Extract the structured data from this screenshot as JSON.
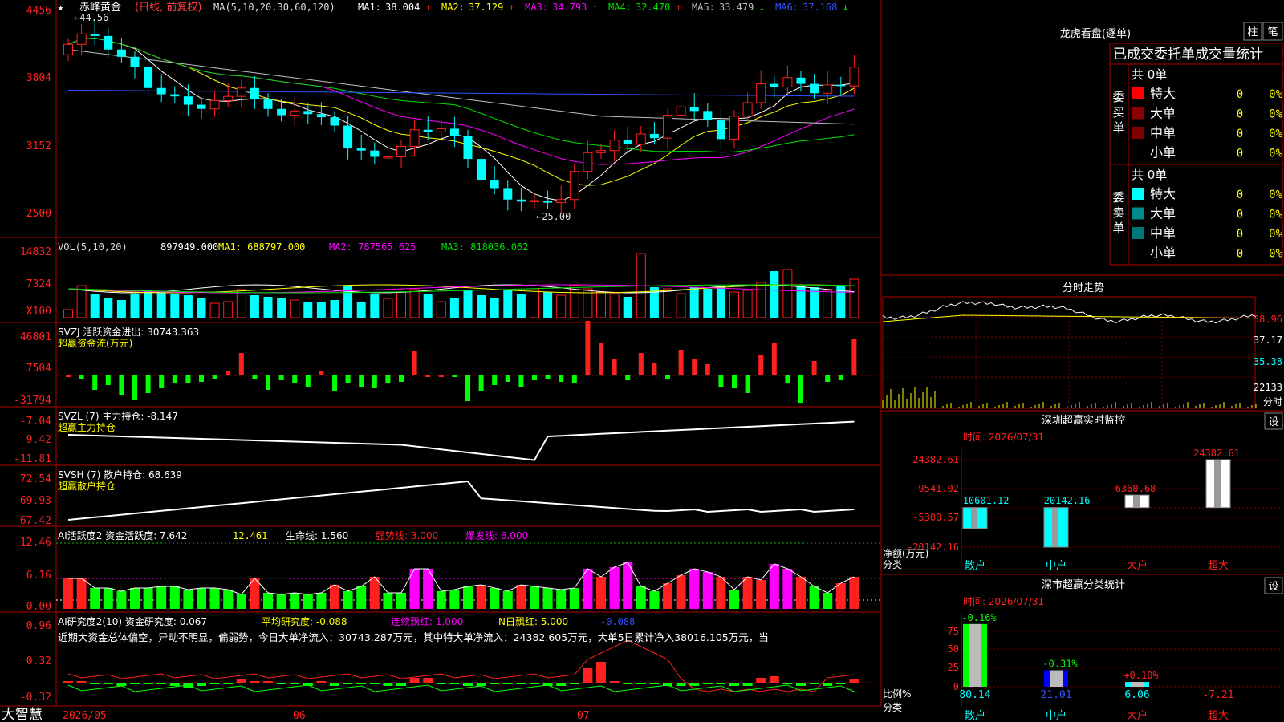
{
  "stock": {
    "name": "赤峰黄金",
    "period": "(日线, 前复权)",
    "ma_params": "MA(5,10,20,30,60,120)",
    "mas": [
      {
        "name": "MA1:",
        "value": "38.004",
        "arrow": "↑",
        "color": "#ffffff"
      },
      {
        "name": "MA2:",
        "value": "37.129",
        "arrow": "↑",
        "color": "#ffff00"
      },
      {
        "name": "MA3:",
        "value": "34.793",
        "arrow": "↑",
        "color": "#ff00ff"
      },
      {
        "name": "MA4:",
        "value": "32.470",
        "arrow": "↑",
        "color": "#00e000"
      },
      {
        "name": "MA5:",
        "value": "33.479",
        "arrow": "↓",
        "color": "#c0c0c0"
      },
      {
        "name": "MA6:",
        "value": "37.168",
        "arrow": "↓",
        "color": "#3050ff"
      }
    ],
    "high_marker": "←44.56",
    "low_marker": "←25.00"
  },
  "left_axis": {
    "main": [
      "4456",
      "3804",
      "3152",
      "2500"
    ],
    "vol": [
      "14832",
      "7324",
      "X100"
    ],
    "svzj": [
      "46801",
      "7504",
      "-31794"
    ],
    "svzl": [
      "-7.04",
      "-9.42",
      "-11.81"
    ],
    "svsh": [
      "72.54",
      "69.93",
      "67.42"
    ],
    "ai1": [
      "12.46",
      "6.16",
      "0.00"
    ],
    "ai2": [
      "0.96",
      "0.32",
      "-0.32"
    ]
  },
  "indicators": {
    "vol": {
      "params": "VOL(5,10,20)",
      "value": "897949.000",
      "ma1": "MA1: 688797.000",
      "ma2": "MA2: 787565.625",
      "ma3": "MA3: 818036.062"
    },
    "svzj": {
      "title": "SVZJ  活跃资金进出: 30743.363",
      "subtitle": "超赢资金流(万元)"
    },
    "svzl": {
      "title": "SVZL (7) 主力持仓: -8.147",
      "subtitle": "超赢主力持仓"
    },
    "svsh": {
      "title": "SVSH (7) 散户持仓: 68.639",
      "subtitle": "超赢散户持仓"
    },
    "ai1": {
      "title": "AI活跃度2 资金活跃度: 7.642",
      "v2": "12.461",
      "life": "生命线: 1.560",
      "strong": "强势线: 3.000",
      "burst": "爆发线: 6.000"
    },
    "ai2": {
      "title": "AI研究度2(10) 资金研究度: 0.067",
      "avg": "平均研究度: -0.088",
      "red": "连续飘红: 1.000",
      "nred": "N日飘红: 5.000",
      "last": "-0.088"
    },
    "comment": "近期大资金总体偏空，异动不明显，偏弱势，今日大单净流入：30743.287万元，其中特大单净流入：24382.605万元，大单5日累计净入38016.105万元，当"
  },
  "date_axis": [
    "2026/05",
    "06",
    "07"
  ],
  "brand": "大智慧",
  "right": {
    "longhu_title": "龙虎看盘(逐单)",
    "tab1": "柱",
    "tab2": "笔",
    "stats_title": "已成交委托单成交量统计",
    "buy_side": "委买单",
    "sell_side": "委卖单",
    "buy_total": "共 0单",
    "sell_total": "共 0单",
    "categories": [
      "特大",
      "大单",
      "中单",
      "小单"
    ],
    "buy_colors": [
      "#ff0000",
      "#8b0000",
      "#800000",
      ""
    ],
    "sell_colors": [
      "#00ffff",
      "#008b8b",
      "#007878",
      ""
    ],
    "zero": "0",
    "pct": "0%",
    "intraday_title": "分时走势",
    "intraday_axis": [
      "38.96",
      "37.17",
      "35.38",
      "22133"
    ],
    "intraday_unit": "分时",
    "monitor_title": "深圳超赢实时监控",
    "monitor_time": "时间: 2026/07/31",
    "monitor_axis": [
      "24382.61",
      "9541.02",
      "-5300.57",
      "-20142.16"
    ],
    "monitor_ylabel": "净额(万元)",
    "monitor_xlabel": "分类",
    "classify_title": "深市超赢分类统计",
    "classify_time": "时间: 2026/07/31",
    "classify_axis": [
      "75",
      "50",
      "25",
      "0"
    ],
    "classify_ylabel": "比例%",
    "classify_xlabel": "分类",
    "set_btn": "设"
  },
  "chart_data": [
    {
      "type": "bar",
      "title": "深圳超赢实时监控",
      "categories": [
        "散户",
        "中户",
        "大户",
        "超大"
      ],
      "values": [
        -10601.12,
        -20142.16,
        6360.68,
        24382.61
      ],
      "labels": [
        "-10601.12",
        "-20142.16",
        "6360.68",
        "24382.61"
      ],
      "ylim": [
        -20142.16,
        24382.61
      ]
    },
    {
      "type": "bar",
      "title": "深市超赢分类统计",
      "categories": [
        "散户",
        "中户",
        "大户",
        "超大"
      ],
      "values": [
        80.14,
        21.01,
        6.06,
        -7.21
      ],
      "top_labels": [
        "-0.16%",
        "-0.31%",
        "+0.10%",
        ""
      ],
      "ylim": [
        0,
        80
      ]
    },
    {
      "type": "candlestick",
      "title": "赤峰黄金 日线",
      "ylim": [
        25.0,
        44.56
      ],
      "close": [
        42.0,
        43.0,
        42.8,
        41.5,
        40.8,
        39.8,
        37.8,
        37.2,
        37.0,
        36.2,
        35.8,
        36.6,
        37.0,
        37.8,
        36.7,
        35.8,
        35.2,
        35.6,
        35.3,
        35.0,
        34.2,
        32.0,
        31.8,
        31.2,
        31.2,
        32.2,
        33.8,
        33.6,
        33.9,
        33.2,
        31.0,
        29.0,
        28.2,
        27.1,
        26.9,
        27.0,
        26.8,
        27.1,
        29.8,
        31.6,
        31.8,
        32.8,
        32.4,
        33.4,
        33.0,
        35.2,
        36.0,
        35.6,
        34.7,
        32.9,
        35.1,
        36.4,
        38.2,
        37.9,
        38.8,
        38.2,
        37.3,
        38.1,
        38.0,
        39.8
      ]
    }
  ]
}
